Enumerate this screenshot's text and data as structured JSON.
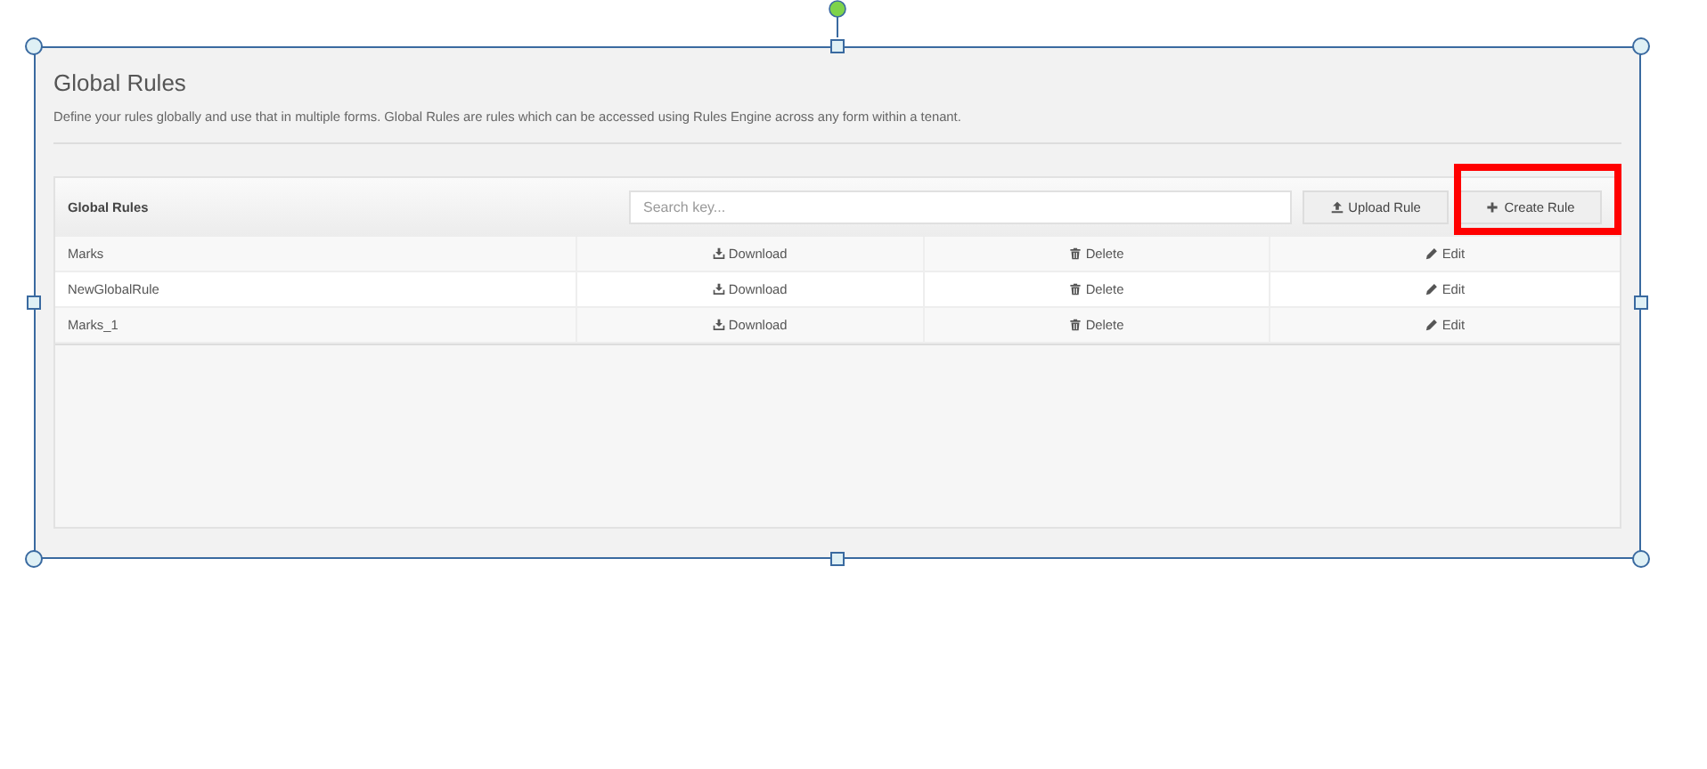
{
  "page": {
    "title": "Global Rules",
    "description": "Define your rules globally and use that in multiple forms. Global Rules are rules which can be accessed using Rules Engine across any form within a tenant."
  },
  "table": {
    "title": "Global Rules",
    "search": {
      "placeholder": "Search key..."
    },
    "buttons": [
      {
        "kind": "upload",
        "label": "Upload Rule",
        "highlighted": false
      },
      {
        "kind": "create",
        "label": "Create Rule",
        "highlighted": true
      }
    ],
    "rows": [
      {
        "name": "Marks",
        "actions": [
          {
            "kind": "download",
            "label": "Download"
          },
          {
            "kind": "delete",
            "label": "Delete"
          },
          {
            "kind": "edit",
            "label": "Edit"
          }
        ]
      },
      {
        "name": "NewGlobalRule",
        "actions": [
          {
            "kind": "download",
            "label": "Download"
          },
          {
            "kind": "delete",
            "label": "Delete"
          },
          {
            "kind": "edit",
            "label": "Edit"
          }
        ]
      },
      {
        "name": "Marks_1",
        "actions": [
          {
            "kind": "download",
            "label": "Download"
          },
          {
            "kind": "delete",
            "label": "Delete"
          },
          {
            "kind": "edit",
            "label": "Edit"
          }
        ]
      }
    ]
  }
}
